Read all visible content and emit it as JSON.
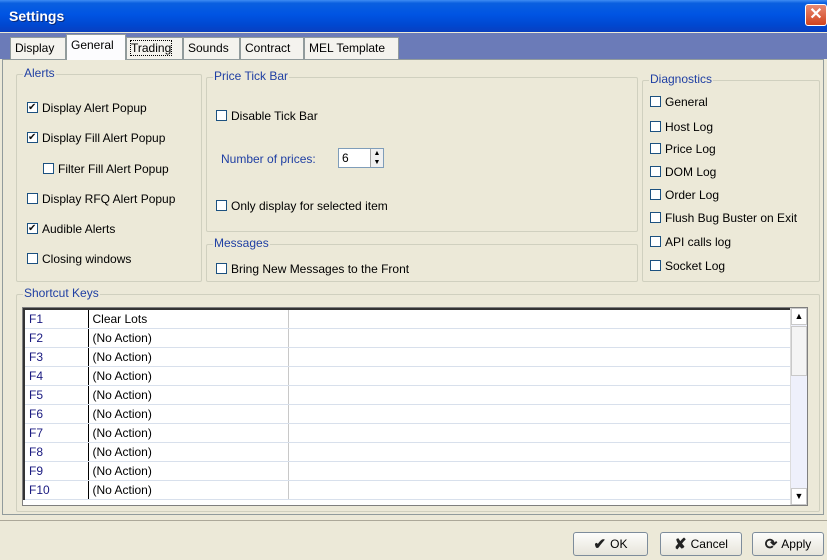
{
  "window": {
    "title": "Settings",
    "close_icon": "close-icon"
  },
  "tabs": [
    {
      "label": "Display"
    },
    {
      "label": "General"
    },
    {
      "label": "Trading"
    },
    {
      "label": "Sounds"
    },
    {
      "label": "Contract"
    },
    {
      "label": "MEL Template"
    }
  ],
  "alerts": {
    "legend": "Alerts",
    "items": [
      {
        "label": "Display Alert Popup",
        "checked": true
      },
      {
        "label": "Display Fill Alert Popup",
        "checked": true
      },
      {
        "label": "Filter Fill Alert Popup",
        "checked": false
      },
      {
        "label": "Display RFQ Alert Popup",
        "checked": false
      },
      {
        "label": "Audible Alerts",
        "checked": true
      },
      {
        "label": "Closing windows",
        "checked": false
      }
    ]
  },
  "price_tick_bar": {
    "legend": "Price Tick Bar",
    "disable_label": "Disable Tick Bar",
    "number_label": "Number of prices:",
    "number_value": "6",
    "only_display_label": "Only display for selected item"
  },
  "messages": {
    "legend": "Messages",
    "bring_front_label": "Bring New Messages to the Front"
  },
  "diagnostics": {
    "legend": "Diagnostics",
    "items": [
      {
        "label": "General"
      },
      {
        "label": "Host Log"
      },
      {
        "label": "Price Log"
      },
      {
        "label": "DOM Log"
      },
      {
        "label": "Order Log"
      },
      {
        "label": "Flush Bug Buster on Exit"
      },
      {
        "label": "API calls log"
      },
      {
        "label": "Socket Log"
      }
    ]
  },
  "shortcuts": {
    "legend": "Shortcut Keys",
    "rows": [
      {
        "key": "F1",
        "action": "Clear Lots"
      },
      {
        "key": "F2",
        "action": "(No Action)"
      },
      {
        "key": "F3",
        "action": "(No Action)"
      },
      {
        "key": "F4",
        "action": "(No Action)"
      },
      {
        "key": "F5",
        "action": "(No Action)"
      },
      {
        "key": "F6",
        "action": "(No Action)"
      },
      {
        "key": "F7",
        "action": "(No Action)"
      },
      {
        "key": "F8",
        "action": "(No Action)"
      },
      {
        "key": "F9",
        "action": "(No Action)"
      },
      {
        "key": "F10",
        "action": "(No Action)"
      }
    ]
  },
  "buttons": {
    "ok": "OK",
    "cancel": "Cancel",
    "apply": "Apply"
  }
}
